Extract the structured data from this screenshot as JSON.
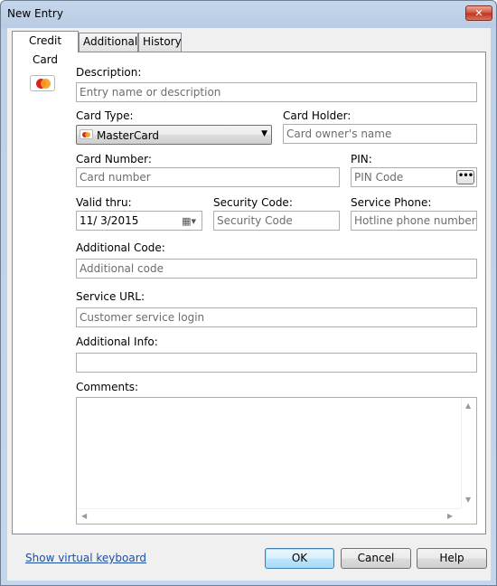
{
  "window": {
    "title": "New Entry",
    "close_label": "✕"
  },
  "tabs": [
    {
      "label": "Credit Card"
    },
    {
      "label": "Additional"
    },
    {
      "label": "History"
    }
  ],
  "form": {
    "description": {
      "label": "Description:",
      "placeholder": "Entry name or description"
    },
    "card_type": {
      "label": "Card Type:",
      "value": "MasterCard"
    },
    "card_holder": {
      "label": "Card Holder:",
      "placeholder": "Card owner's name"
    },
    "card_number": {
      "label": "Card Number:",
      "placeholder": "Card number"
    },
    "pin": {
      "label": "PIN:",
      "placeholder": "PIN Code",
      "button": "•••"
    },
    "valid_thru": {
      "label": "Valid thru:",
      "value": "11/  3/2015"
    },
    "security_code": {
      "label": "Security Code:",
      "placeholder": "Security Code"
    },
    "service_phone": {
      "label": "Service Phone:",
      "placeholder": "Hotline phone number"
    },
    "additional_code": {
      "label": "Additional Code:",
      "placeholder": "Additional code"
    },
    "service_url": {
      "label": "Service URL:",
      "placeholder": "Customer service login"
    },
    "additional_info": {
      "label": "Additional Info:",
      "value": ""
    },
    "comments": {
      "label": "Comments:",
      "value": ""
    }
  },
  "footer": {
    "virtual_keyboard_link": "Show virtual keyboard",
    "ok_label": "OK",
    "cancel_label": "Cancel",
    "help_label": "Help"
  },
  "icons": {
    "card_icon": "mastercard-icon",
    "calendar": "calendar-icon"
  },
  "colors": {
    "link": "#1c4fa1",
    "close_button": "#c2311a",
    "mastercard_red": "#d9241c",
    "mastercard_orange": "#f5a01a"
  }
}
